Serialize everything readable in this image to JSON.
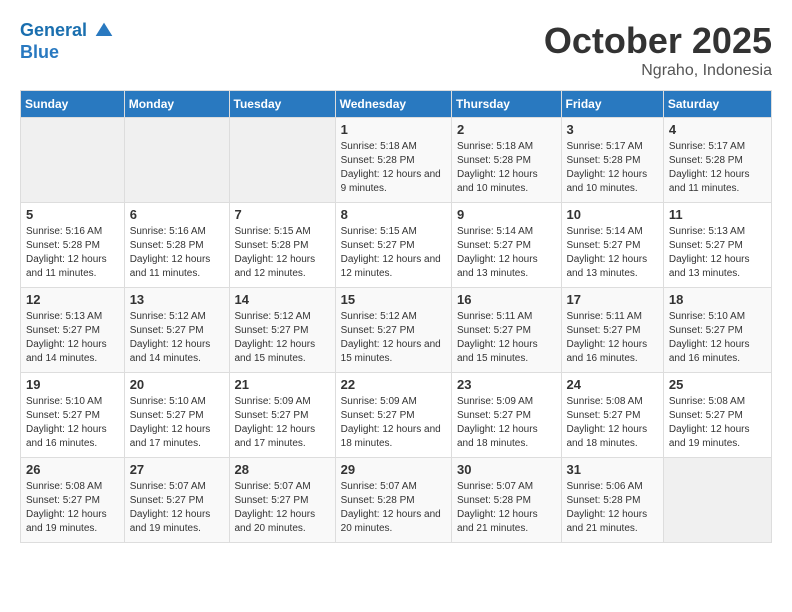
{
  "header": {
    "logo_line1": "General",
    "logo_line2": "Blue",
    "month": "October 2025",
    "location": "Ngraho, Indonesia"
  },
  "weekdays": [
    "Sunday",
    "Monday",
    "Tuesday",
    "Wednesday",
    "Thursday",
    "Friday",
    "Saturday"
  ],
  "weeks": [
    [
      {
        "day": "",
        "sunrise": "",
        "sunset": "",
        "daylight": ""
      },
      {
        "day": "",
        "sunrise": "",
        "sunset": "",
        "daylight": ""
      },
      {
        "day": "",
        "sunrise": "",
        "sunset": "",
        "daylight": ""
      },
      {
        "day": "1",
        "sunrise": "Sunrise: 5:18 AM",
        "sunset": "Sunset: 5:28 PM",
        "daylight": "Daylight: 12 hours and 9 minutes."
      },
      {
        "day": "2",
        "sunrise": "Sunrise: 5:18 AM",
        "sunset": "Sunset: 5:28 PM",
        "daylight": "Daylight: 12 hours and 10 minutes."
      },
      {
        "day": "3",
        "sunrise": "Sunrise: 5:17 AM",
        "sunset": "Sunset: 5:28 PM",
        "daylight": "Daylight: 12 hours and 10 minutes."
      },
      {
        "day": "4",
        "sunrise": "Sunrise: 5:17 AM",
        "sunset": "Sunset: 5:28 PM",
        "daylight": "Daylight: 12 hours and 11 minutes."
      }
    ],
    [
      {
        "day": "5",
        "sunrise": "Sunrise: 5:16 AM",
        "sunset": "Sunset: 5:28 PM",
        "daylight": "Daylight: 12 hours and 11 minutes."
      },
      {
        "day": "6",
        "sunrise": "Sunrise: 5:16 AM",
        "sunset": "Sunset: 5:28 PM",
        "daylight": "Daylight: 12 hours and 11 minutes."
      },
      {
        "day": "7",
        "sunrise": "Sunrise: 5:15 AM",
        "sunset": "Sunset: 5:28 PM",
        "daylight": "Daylight: 12 hours and 12 minutes."
      },
      {
        "day": "8",
        "sunrise": "Sunrise: 5:15 AM",
        "sunset": "Sunset: 5:27 PM",
        "daylight": "Daylight: 12 hours and 12 minutes."
      },
      {
        "day": "9",
        "sunrise": "Sunrise: 5:14 AM",
        "sunset": "Sunset: 5:27 PM",
        "daylight": "Daylight: 12 hours and 13 minutes."
      },
      {
        "day": "10",
        "sunrise": "Sunrise: 5:14 AM",
        "sunset": "Sunset: 5:27 PM",
        "daylight": "Daylight: 12 hours and 13 minutes."
      },
      {
        "day": "11",
        "sunrise": "Sunrise: 5:13 AM",
        "sunset": "Sunset: 5:27 PM",
        "daylight": "Daylight: 12 hours and 13 minutes."
      }
    ],
    [
      {
        "day": "12",
        "sunrise": "Sunrise: 5:13 AM",
        "sunset": "Sunset: 5:27 PM",
        "daylight": "Daylight: 12 hours and 14 minutes."
      },
      {
        "day": "13",
        "sunrise": "Sunrise: 5:12 AM",
        "sunset": "Sunset: 5:27 PM",
        "daylight": "Daylight: 12 hours and 14 minutes."
      },
      {
        "day": "14",
        "sunrise": "Sunrise: 5:12 AM",
        "sunset": "Sunset: 5:27 PM",
        "daylight": "Daylight: 12 hours and 15 minutes."
      },
      {
        "day": "15",
        "sunrise": "Sunrise: 5:12 AM",
        "sunset": "Sunset: 5:27 PM",
        "daylight": "Daylight: 12 hours and 15 minutes."
      },
      {
        "day": "16",
        "sunrise": "Sunrise: 5:11 AM",
        "sunset": "Sunset: 5:27 PM",
        "daylight": "Daylight: 12 hours and 15 minutes."
      },
      {
        "day": "17",
        "sunrise": "Sunrise: 5:11 AM",
        "sunset": "Sunset: 5:27 PM",
        "daylight": "Daylight: 12 hours and 16 minutes."
      },
      {
        "day": "18",
        "sunrise": "Sunrise: 5:10 AM",
        "sunset": "Sunset: 5:27 PM",
        "daylight": "Daylight: 12 hours and 16 minutes."
      }
    ],
    [
      {
        "day": "19",
        "sunrise": "Sunrise: 5:10 AM",
        "sunset": "Sunset: 5:27 PM",
        "daylight": "Daylight: 12 hours and 16 minutes."
      },
      {
        "day": "20",
        "sunrise": "Sunrise: 5:10 AM",
        "sunset": "Sunset: 5:27 PM",
        "daylight": "Daylight: 12 hours and 17 minutes."
      },
      {
        "day": "21",
        "sunrise": "Sunrise: 5:09 AM",
        "sunset": "Sunset: 5:27 PM",
        "daylight": "Daylight: 12 hours and 17 minutes."
      },
      {
        "day": "22",
        "sunrise": "Sunrise: 5:09 AM",
        "sunset": "Sunset: 5:27 PM",
        "daylight": "Daylight: 12 hours and 18 minutes."
      },
      {
        "day": "23",
        "sunrise": "Sunrise: 5:09 AM",
        "sunset": "Sunset: 5:27 PM",
        "daylight": "Daylight: 12 hours and 18 minutes."
      },
      {
        "day": "24",
        "sunrise": "Sunrise: 5:08 AM",
        "sunset": "Sunset: 5:27 PM",
        "daylight": "Daylight: 12 hours and 18 minutes."
      },
      {
        "day": "25",
        "sunrise": "Sunrise: 5:08 AM",
        "sunset": "Sunset: 5:27 PM",
        "daylight": "Daylight: 12 hours and 19 minutes."
      }
    ],
    [
      {
        "day": "26",
        "sunrise": "Sunrise: 5:08 AM",
        "sunset": "Sunset: 5:27 PM",
        "daylight": "Daylight: 12 hours and 19 minutes."
      },
      {
        "day": "27",
        "sunrise": "Sunrise: 5:07 AM",
        "sunset": "Sunset: 5:27 PM",
        "daylight": "Daylight: 12 hours and 19 minutes."
      },
      {
        "day": "28",
        "sunrise": "Sunrise: 5:07 AM",
        "sunset": "Sunset: 5:27 PM",
        "daylight": "Daylight: 12 hours and 20 minutes."
      },
      {
        "day": "29",
        "sunrise": "Sunrise: 5:07 AM",
        "sunset": "Sunset: 5:28 PM",
        "daylight": "Daylight: 12 hours and 20 minutes."
      },
      {
        "day": "30",
        "sunrise": "Sunrise: 5:07 AM",
        "sunset": "Sunset: 5:28 PM",
        "daylight": "Daylight: 12 hours and 21 minutes."
      },
      {
        "day": "31",
        "sunrise": "Sunrise: 5:06 AM",
        "sunset": "Sunset: 5:28 PM",
        "daylight": "Daylight: 12 hours and 21 minutes."
      },
      {
        "day": "",
        "sunrise": "",
        "sunset": "",
        "daylight": ""
      }
    ]
  ]
}
